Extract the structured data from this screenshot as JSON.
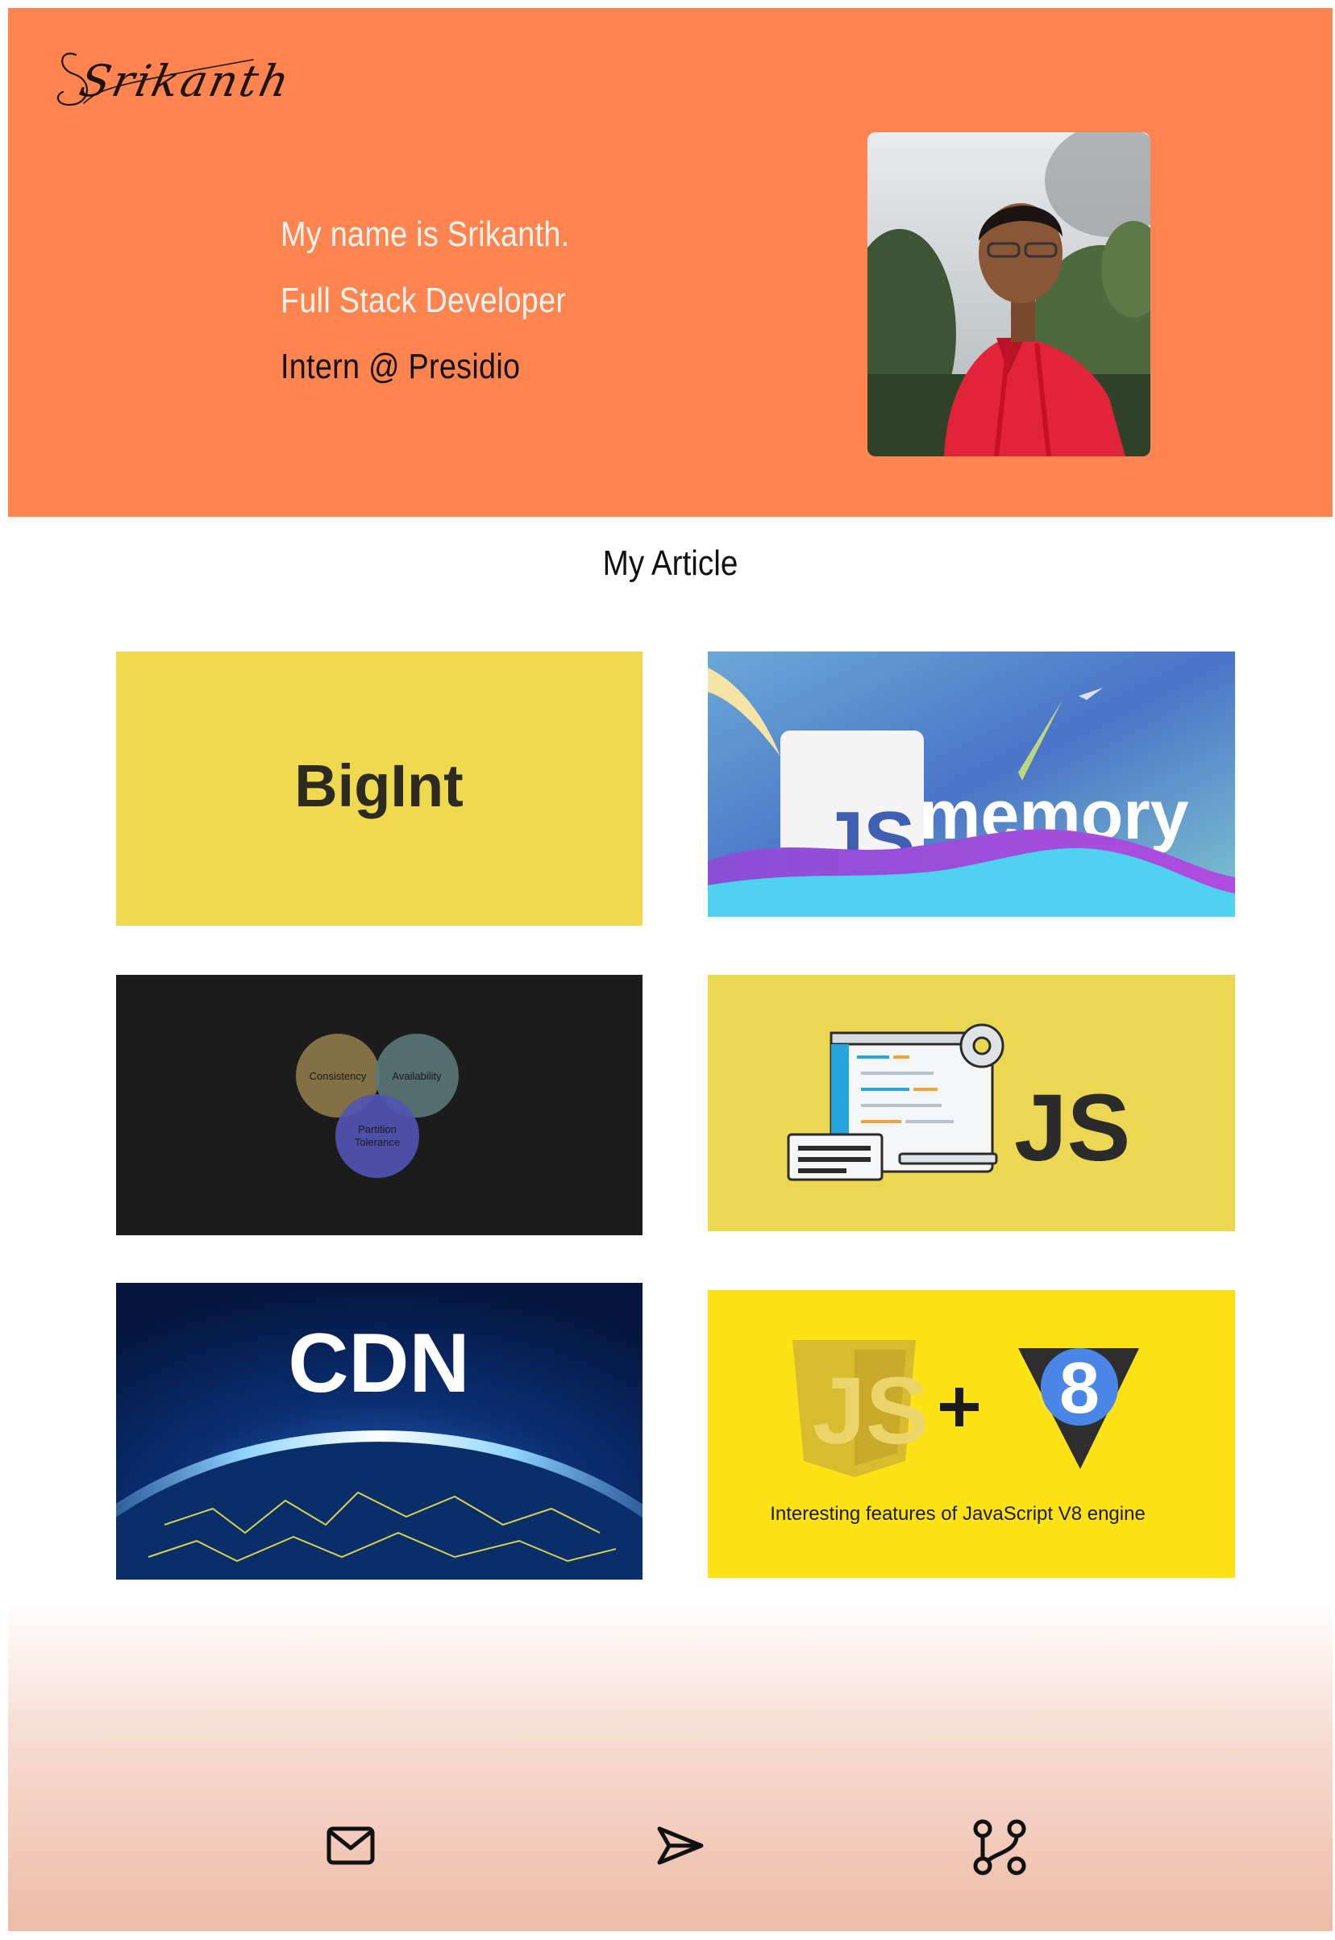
{
  "header": {
    "logo_text": "Srikanth",
    "intro": [
      "My name is Srikanth.",
      "Full Stack Developer",
      "Intern @ Presidio"
    ]
  },
  "section": {
    "title": "My Article"
  },
  "articles": [
    {
      "thumb_text": "BigInt",
      "bg": "#efd94f"
    },
    {
      "thumb_text": "JS",
      "thumb_text_2": "memory"
    },
    {
      "venn": [
        "Consistency",
        "Availability",
        "Partition",
        "Tolerance"
      ]
    },
    {
      "thumb_text": "JS",
      "bg": "#ecd752"
    },
    {
      "thumb_text": "CDN"
    },
    {
      "thumb_text": "JS",
      "thumb_text_2": "8",
      "caption": "Interesting features of JavaScript V8 engine",
      "bg": "#fde316"
    }
  ],
  "footer": {
    "icons": [
      "mail-icon",
      "send-icon",
      "git-branch-icon"
    ]
  },
  "colors": {
    "hero_bg": "#ff844f",
    "accent_yellow": "#efd94f"
  }
}
